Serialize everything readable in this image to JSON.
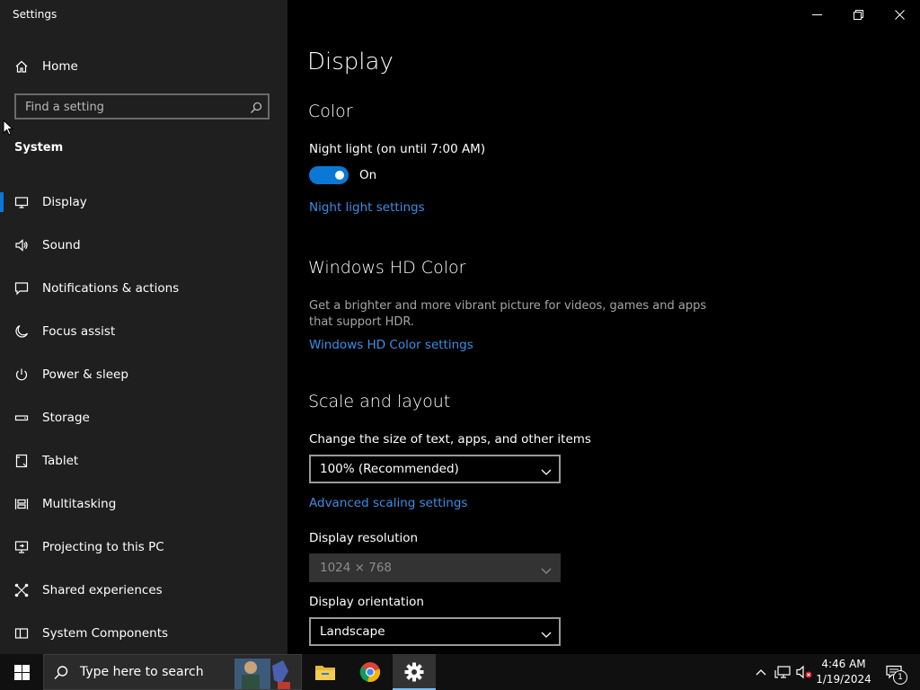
{
  "window": {
    "title": "Settings"
  },
  "sidebar": {
    "home_label": "Home",
    "search_placeholder": "Find a setting",
    "section_label": "System",
    "items": [
      {
        "label": "Display",
        "icon": "monitor-icon"
      },
      {
        "label": "Sound",
        "icon": "speaker-icon"
      },
      {
        "label": "Notifications & actions",
        "icon": "message-icon"
      },
      {
        "label": "Focus assist",
        "icon": "moon-icon"
      },
      {
        "label": "Power & sleep",
        "icon": "power-icon"
      },
      {
        "label": "Storage",
        "icon": "storage-icon"
      },
      {
        "label": "Tablet",
        "icon": "tablet-icon"
      },
      {
        "label": "Multitasking",
        "icon": "multitasking-icon"
      },
      {
        "label": "Projecting to this PC",
        "icon": "projecting-icon"
      },
      {
        "label": "Shared experiences",
        "icon": "shared-icon"
      },
      {
        "label": "System Components",
        "icon": "components-icon"
      }
    ]
  },
  "main": {
    "title": "Display",
    "color": {
      "heading": "Color",
      "night_light_label": "Night light (on until 7:00 AM)",
      "toggle_state": "On",
      "night_light_link": "Night light settings"
    },
    "hdr": {
      "heading": "Windows HD Color",
      "description": "Get a brighter and more vibrant picture for videos, games and apps that support HDR.",
      "link": "Windows HD Color settings"
    },
    "scale": {
      "heading": "Scale and layout",
      "size_label": "Change the size of text, apps, and other items",
      "size_value": "100% (Recommended)",
      "advanced_link": "Advanced scaling settings",
      "resolution_label": "Display resolution",
      "resolution_value": "1024 × 768",
      "orientation_label": "Display orientation",
      "orientation_value": "Landscape"
    }
  },
  "taskbar": {
    "search_placeholder": "Type here to search",
    "clock_time": "4:46 AM",
    "clock_date": "1/19/2024",
    "notification_count": "1"
  },
  "colors": {
    "accent": "#0a78d4",
    "link": "#3a8ee6",
    "sidebar_bg": "#1f1f1f",
    "main_bg": "#000000"
  }
}
